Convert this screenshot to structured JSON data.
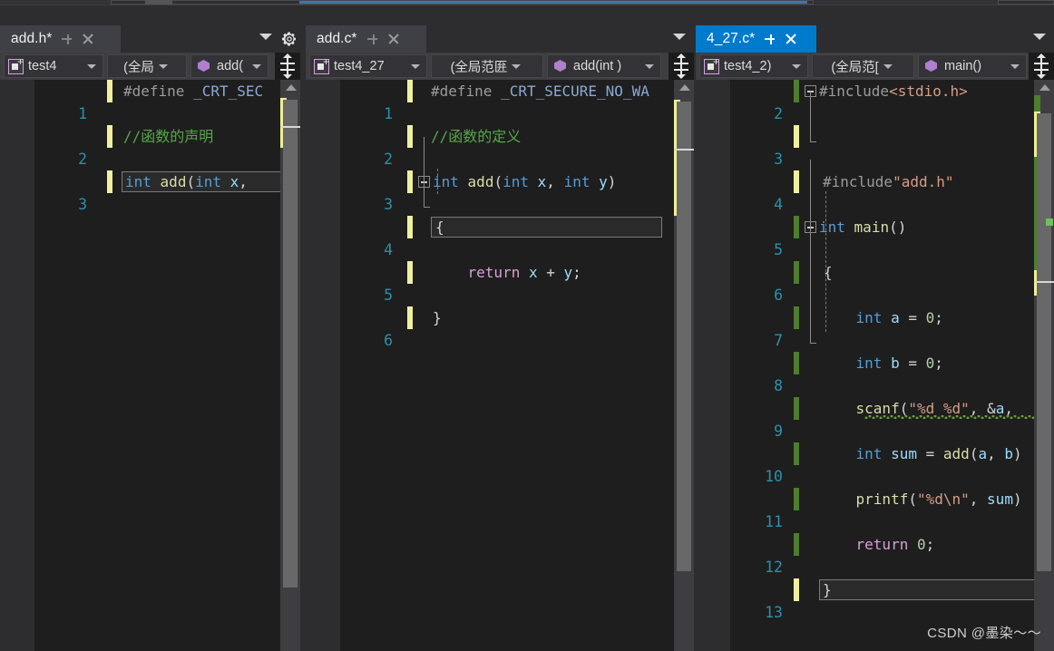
{
  "window": {
    "watermark": "CSDN @墨染～～"
  },
  "panes": [
    {
      "id": "pane-add-h",
      "tab": {
        "title": "add.h*",
        "pin_icon": "pin-icon",
        "close_icon": "close-icon"
      },
      "tab_overflow_icon": "chevron-down-icon",
      "settings_icon": "gear-icon",
      "nav": {
        "project": "test4",
        "project_icon": "project-icon",
        "scope": "(全局",
        "member": "add(",
        "member_icon": "member-icon",
        "split_icon": "split-view-icon"
      },
      "lines": [
        {
          "no": "1",
          "change": "yellow",
          "text": "#define _CRT_SEC"
        },
        {
          "no": "2",
          "change": "yellow",
          "text": "//函数的声明"
        },
        {
          "no": "3",
          "change": "yellow",
          "text": "int add(int x, "
        }
      ]
    },
    {
      "id": "pane-add-c",
      "tab": {
        "title": "add.c*",
        "pin_icon": "pin-icon",
        "close_icon": "close-icon"
      },
      "tab_overflow_icon": "chevron-down-icon",
      "nav": {
        "project": "test4_27",
        "project_icon": "project-icon",
        "scope": "(全局范匥",
        "member": "add(int )",
        "member_icon": "member-icon",
        "split_icon": "split-view-icon"
      },
      "lines": [
        {
          "no": "1",
          "change": "yellow",
          "text": "#define _CRT_SECURE_NO_WA"
        },
        {
          "no": "2",
          "change": "yellow",
          "text": "//函数的定义"
        },
        {
          "no": "3",
          "change": "yellow",
          "text": "int add(int x, int y)"
        },
        {
          "no": "4",
          "change": "yellow",
          "text": "{"
        },
        {
          "no": "5",
          "change": "yellow",
          "text": "    return x + y;"
        },
        {
          "no": "6",
          "change": "yellow",
          "text": "}"
        }
      ]
    },
    {
      "id": "pane-4-27-c",
      "tab": {
        "title": "4_27.c*",
        "pin_icon": "pin-icon",
        "close_icon": "close-icon",
        "active": true
      },
      "tab_overflow_icon": "chevron-down-icon",
      "nav": {
        "project": "test4_2)",
        "project_icon": "project-icon",
        "scope": "(全局范[",
        "member": "main()",
        "member_icon": "member-icon",
        "split_icon": "split-view-icon"
      },
      "lines": [
        {
          "no": "2",
          "change": "green",
          "text": "#include<stdio.h>"
        },
        {
          "no": "3",
          "change": "yellow",
          "text": ""
        },
        {
          "no": "4",
          "change": "yellow",
          "text": "#include\"add.h\""
        },
        {
          "no": "5",
          "change": "green",
          "text": "int main()"
        },
        {
          "no": "6",
          "change": "green",
          "text": "{"
        },
        {
          "no": "7",
          "change": "green",
          "text": "    int a = 0;"
        },
        {
          "no": "8",
          "change": "green",
          "text": "    int b = 0;"
        },
        {
          "no": "9",
          "change": "green",
          "text": "    scanf(\"%d %d\", &a,"
        },
        {
          "no": "10",
          "change": "green",
          "text": "    int sum = add(a, b)"
        },
        {
          "no": "11",
          "change": "green",
          "text": "    printf(\"%d\\n\", sum)"
        },
        {
          "no": "12",
          "change": "green",
          "text": "    return 0;"
        },
        {
          "no": "13",
          "change": "yellow",
          "text": "}"
        }
      ]
    }
  ],
  "colors": {
    "active_tab": "#007acc",
    "inactive_tab": "#3f3f46",
    "editor_bg": "#1e1e1e",
    "chrome_bg": "#2d2d30",
    "navbar_bg": "#3e3e42",
    "lineno": "#2b91af",
    "comment": "#57a64a",
    "keyword": "#569cd6",
    "string": "#d69d85",
    "function": "#dcdcaa",
    "change_unsaved": "#f0f0a0",
    "change_saved": "#4e7d2e"
  }
}
